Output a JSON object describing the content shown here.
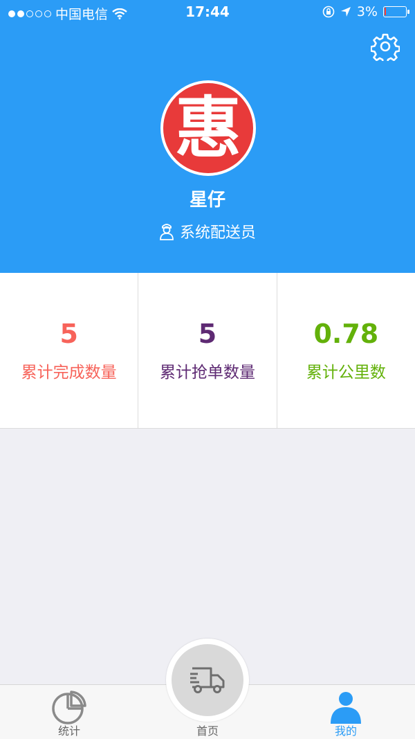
{
  "status_bar": {
    "carrier": "中国电信",
    "time": "17:44",
    "battery": "3%",
    "signal_bars_filled": 2
  },
  "profile": {
    "avatar_char": "惠",
    "name": "星仔",
    "role": "系统配送员"
  },
  "stats": [
    {
      "value": "5",
      "label": "累计完成数量",
      "color": "#f7635a"
    },
    {
      "value": "5",
      "label": "累计抢单数量",
      "color": "#5e2a73"
    },
    {
      "value": "0.78",
      "label": "累计公里数",
      "color": "#63b10a"
    }
  ],
  "tabbar": {
    "tabs": [
      {
        "label": "统计",
        "icon": "pie-chart-icon"
      },
      {
        "label": "首页",
        "icon": "truck-icon"
      },
      {
        "label": "我的",
        "icon": "user-icon"
      }
    ],
    "active_index": 2
  },
  "colors": {
    "header_bg": "#2b9cf6",
    "avatar_red": "#e83a3a",
    "active_tab": "#2b9cf6",
    "page_bg": "#efeff4"
  }
}
